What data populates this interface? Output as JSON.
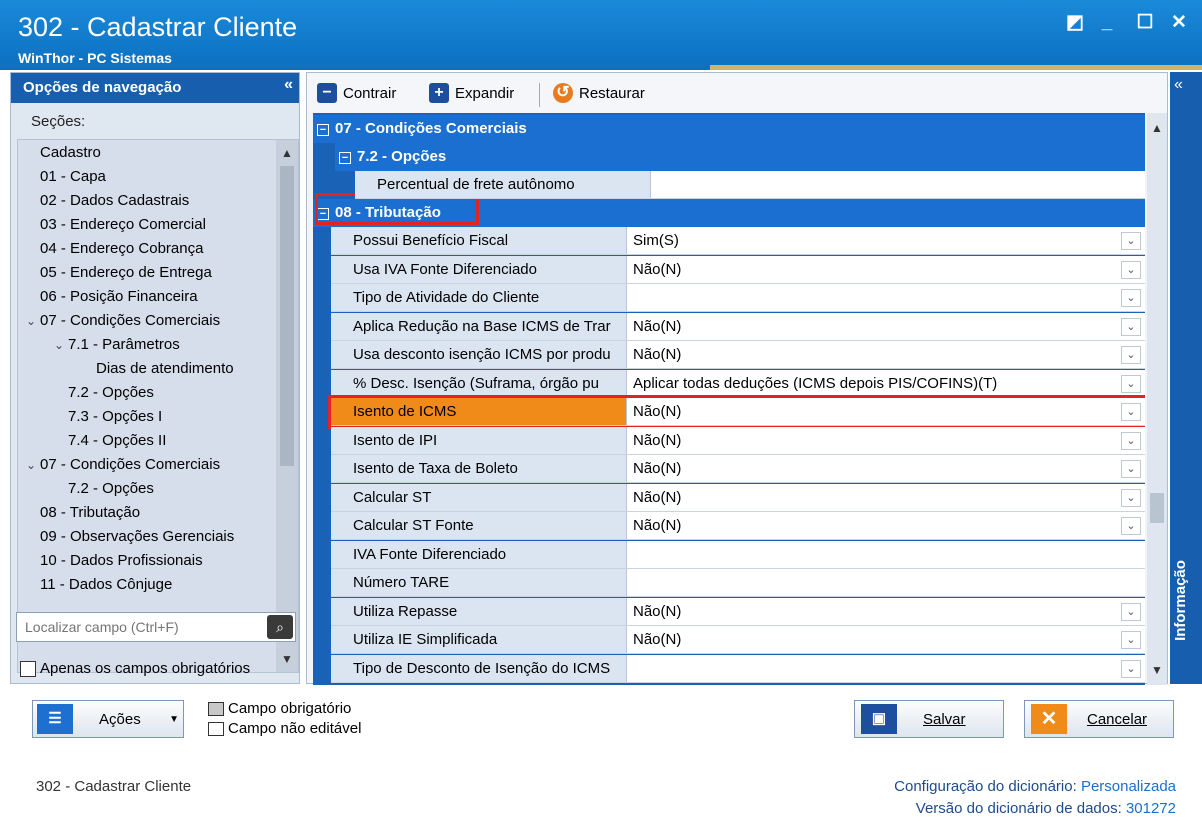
{
  "window": {
    "title": "302 - Cadastrar Cliente",
    "subtitle": "WinThor - PC Sistemas",
    "controls": [
      "◩",
      "_",
      "☐",
      "✕"
    ]
  },
  "nav": {
    "header": "Opções de navegação",
    "collapse": "«",
    "sections_label": "Seções:",
    "items": [
      {
        "label": "Cadastro",
        "level": 0,
        "expander": ""
      },
      {
        "label": "01 - Capa",
        "level": 0,
        "expander": ""
      },
      {
        "label": "02 - Dados Cadastrais",
        "level": 0,
        "expander": ""
      },
      {
        "label": "03 - Endereço Comercial",
        "level": 0,
        "expander": ""
      },
      {
        "label": "04 - Endereço Cobrança",
        "level": 0,
        "expander": ""
      },
      {
        "label": "05 - Endereço de Entrega",
        "level": 0,
        "expander": ""
      },
      {
        "label": "06 - Posição Financeira",
        "level": 0,
        "expander": ""
      },
      {
        "label": "07 - Condições Comerciais",
        "level": 0,
        "expander": "v"
      },
      {
        "label": "7.1 - Parâmetros",
        "level": 1,
        "expander": "v"
      },
      {
        "label": "Dias de atendimento",
        "level": 2,
        "expander": ""
      },
      {
        "label": "7.2 - Opções",
        "level": 1,
        "expander": ""
      },
      {
        "label": "7.3 - Opções I",
        "level": 1,
        "expander": ""
      },
      {
        "label": "7.4 - Opções II",
        "level": 1,
        "expander": ""
      },
      {
        "label": "07 - Condições Comerciais",
        "level": 0,
        "expander": "v"
      },
      {
        "label": "7.2 - Opções",
        "level": 1,
        "expander": ""
      },
      {
        "label": "08 - Tributação",
        "level": 0,
        "expander": ""
      },
      {
        "label": "09 - Observações Gerenciais",
        "level": 0,
        "expander": ""
      },
      {
        "label": "10 - Dados Profissionais",
        "level": 0,
        "expander": ""
      },
      {
        "label": "11 - Dados Cônjuge",
        "level": 0,
        "expander": ""
      }
    ],
    "search_placeholder": "Localizar campo (Ctrl+F)",
    "only_required": "Apenas os campos obrigatórios"
  },
  "toolbar": {
    "collapse": "Contrair",
    "expand": "Expandir",
    "restore": "Restaurar"
  },
  "grid": {
    "group1": "07 - Condições Comerciais",
    "group1_sub": "7.2 - Opções",
    "group1_rows": [
      {
        "label": "Percentual de frete autônomo",
        "value": "",
        "dropdown": false
      }
    ],
    "group2": "08 - Tributação",
    "group2_rows": [
      {
        "label": "Possui Benefício Fiscal",
        "value": "Sim(S)",
        "dropdown": true
      },
      {
        "label": "Usa IVA Fonte Diferenciado",
        "value": "Não(N)",
        "dropdown": true
      },
      {
        "label": "Tipo de Atividade do Cliente",
        "value": "",
        "dropdown": true
      },
      {
        "label": "Aplica Redução na Base ICMS de Trar",
        "value": "Não(N)",
        "dropdown": true
      },
      {
        "label": "Usa desconto isenção ICMS por produ",
        "value": "Não(N)",
        "dropdown": true
      },
      {
        "label": "% Desc. Isenção (Suframa, órgão pu",
        "value": "Aplicar todas deduções (ICMS depois PIS/COFINS)(T)",
        "dropdown": true
      },
      {
        "label": "Isento de ICMS",
        "value": "Não(N)",
        "dropdown": true,
        "selected": true
      },
      {
        "label": "Isento de IPI",
        "value": "Não(N)",
        "dropdown": true
      },
      {
        "label": "Isento de Taxa de Boleto",
        "value": "Não(N)",
        "dropdown": true
      },
      {
        "label": "Calcular ST",
        "value": "Não(N)",
        "dropdown": true
      },
      {
        "label": "Calcular ST Fonte",
        "value": "Não(N)",
        "dropdown": true
      },
      {
        "label": "IVA Fonte Diferenciado",
        "value": "",
        "dropdown": false
      },
      {
        "label": "Número TARE",
        "value": "",
        "dropdown": false
      },
      {
        "label": "Utiliza Repasse",
        "value": "Não(N)",
        "dropdown": true
      },
      {
        "label": "Utiliza IE Simplificada",
        "value": "Não(N)",
        "dropdown": true
      },
      {
        "label": "Tipo de Desconto de Isenção do ICMS",
        "value": "",
        "dropdown": true
      }
    ]
  },
  "info_panel": {
    "collapse": "«",
    "label": "Informação"
  },
  "bottom": {
    "actions": "Ações",
    "legend_required": "Campo obrigatório",
    "legend_readonly": "Campo não editável",
    "save": "Salvar",
    "cancel": "Cancelar",
    "status_left": "302 - Cadastrar Cliente",
    "dict_config_label": "Configuração do dicionário:",
    "dict_config_value": "Personalizada",
    "dict_version_label": "Versão do dicionário de dados:",
    "dict_version_value": "301272"
  },
  "colors": {
    "title_bar": "#1a8ad9",
    "nav_header": "#175fae",
    "group_header": "#1b6fd0",
    "selected_row": "#f08a19",
    "highlight": "#e32222"
  }
}
